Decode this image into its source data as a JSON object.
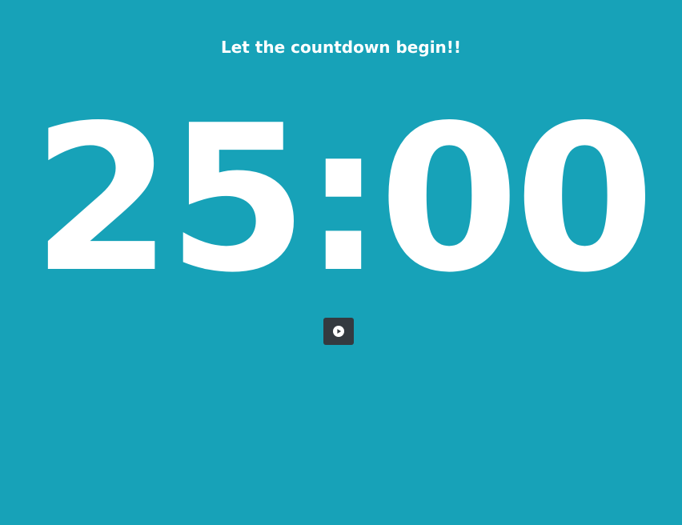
{
  "heading": "Let the countdown begin!!",
  "timer": {
    "display": "25:00"
  },
  "controls": {
    "play_icon": "play-circle-icon"
  },
  "colors": {
    "background": "#17a2b8",
    "text": "#ffffff",
    "button": "#343a40"
  }
}
